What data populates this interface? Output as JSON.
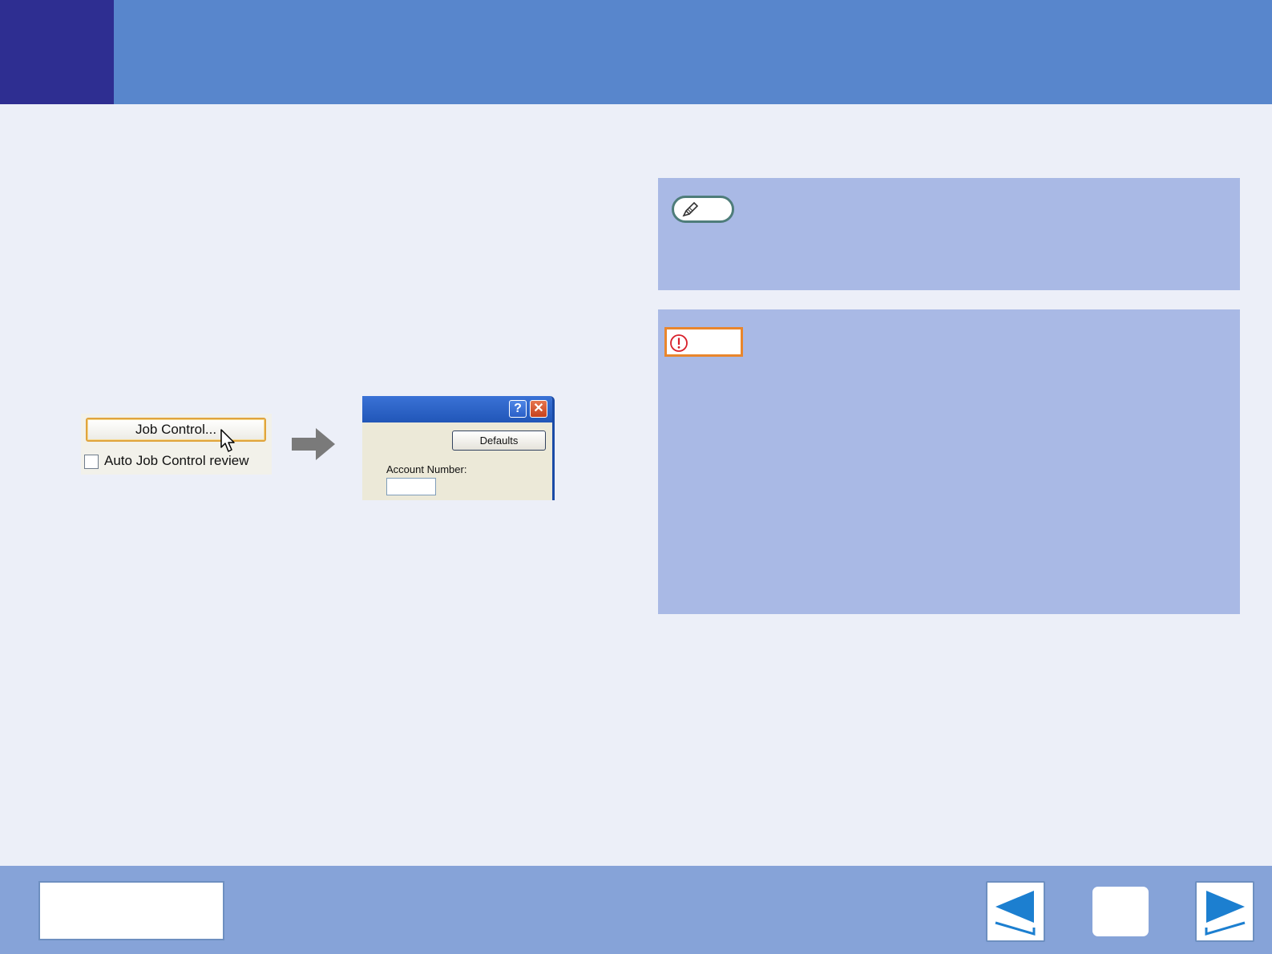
{
  "snippet_left": {
    "job_control_button": "Job Control...",
    "auto_review_label": "Auto Job Control review",
    "auto_review_checked": false
  },
  "dialog": {
    "help_button": "?",
    "close_button": "✕",
    "defaults_button": "Defaults",
    "account_label": "Account Number:",
    "account_value": ""
  },
  "badges": {
    "note_icon": "pencil-icon",
    "caution_icon": "exclamation-icon"
  },
  "colors": {
    "header": "#5886cc",
    "header_square": "#2e2e91",
    "panel": "#a9b9e5",
    "footer": "#86a3d8",
    "nav_arrow": "#1c7fd0",
    "caution_border": "#e9862c",
    "note_border": "#4e7d7a"
  },
  "footer": {
    "prev_icon": "left-triangle-icon",
    "next_icon": "right-triangle-icon",
    "home_icon": "square-button"
  }
}
